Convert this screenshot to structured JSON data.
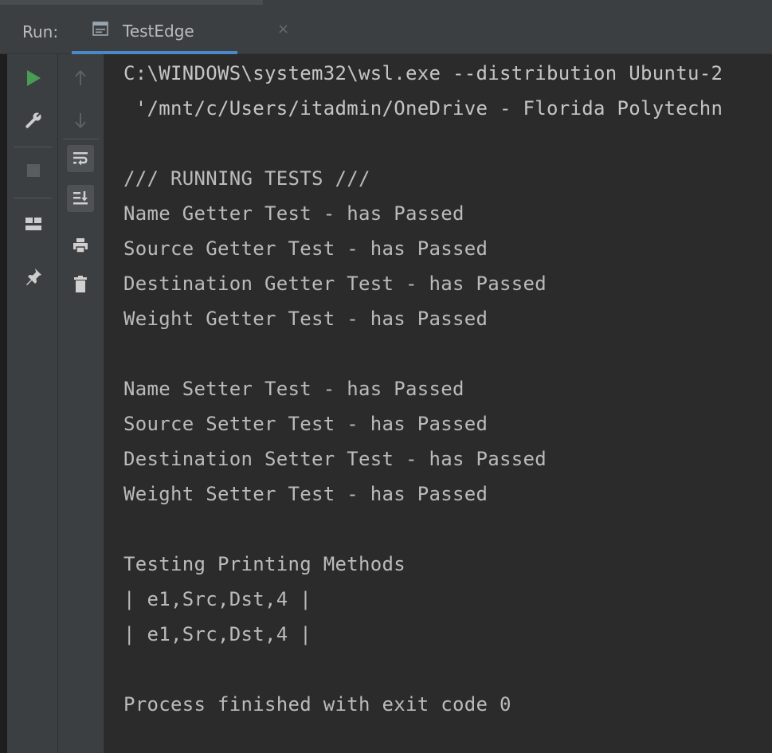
{
  "run_panel": {
    "label": "Run:",
    "tab": {
      "title": "TestEdge",
      "close_glyph": "×",
      "icon": "console-window-icon"
    }
  },
  "toolbar": {
    "left_column": [
      {
        "name": "rerun-icon",
        "tooltip": "Rerun"
      },
      {
        "name": "wrench-icon",
        "tooltip": "Settings"
      },
      {
        "name": "stop-icon",
        "tooltip": "Stop"
      },
      {
        "name": "layout-icon",
        "tooltip": "Restore layout"
      },
      {
        "name": "pin-icon",
        "tooltip": "Pin tab"
      }
    ],
    "right_column": [
      {
        "name": "arrow-up-icon",
        "tooltip": "Up"
      },
      {
        "name": "arrow-down-icon",
        "tooltip": "Down"
      },
      {
        "name": "soft-wrap-icon",
        "tooltip": "Soft-wrap"
      },
      {
        "name": "scroll-to-end-icon",
        "tooltip": "Scroll to end"
      },
      {
        "name": "print-icon",
        "tooltip": "Print"
      },
      {
        "name": "trash-icon",
        "tooltip": "Clear all"
      }
    ]
  },
  "console": {
    "command_line_1": "C:\\WINDOWS\\system32\\wsl.exe --distribution Ubuntu-2",
    "command_line_2": " '/mnt/c/Users/itadmin/OneDrive - Florida Polytechn",
    "running_header": "/// RUNNING TESTS ///",
    "getter_tests": [
      "Name Getter Test - has Passed",
      "Source Getter Test - has Passed",
      "Destination Getter Test - has Passed",
      "Weight Getter Test - has Passed"
    ],
    "setter_tests": [
      "Name Setter Test - has Passed",
      "Source Setter Test - has Passed",
      "Destination Setter Test - has Passed",
      "Weight Setter Test - has Passed"
    ],
    "printing_header": "Testing Printing Methods",
    "printing_output": [
      "| e1,Src,Dst,4 |",
      "| e1,Src,Dst,4 |"
    ],
    "exit_message": "Process finished with exit code 0"
  },
  "colors": {
    "background": "#2b2b2b",
    "toolbar": "#3c3f41",
    "text": "#bbbbbb",
    "run_green": "#499c54",
    "tab_underline": "#4a88c7"
  }
}
